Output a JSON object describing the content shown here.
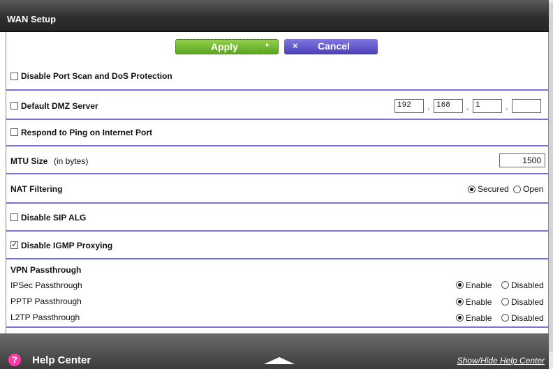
{
  "header": {
    "title": "WAN Setup"
  },
  "toolbar": {
    "apply_label": "Apply",
    "apply_arrow": "▸",
    "cancel_label": "Cancel",
    "cancel_x": "×"
  },
  "settings": {
    "disable_port_scan": {
      "label": "Disable Port Scan and DoS Protection",
      "checked": false
    },
    "default_dmz": {
      "label": "Default DMZ Server",
      "checked": false,
      "ip": [
        "192",
        "168",
        "1",
        ""
      ]
    },
    "respond_ping": {
      "label": "Respond to Ping on Internet Port",
      "checked": false
    },
    "mtu": {
      "label": "MTU Size",
      "unit": "(in bytes)",
      "value": "1500"
    },
    "nat_filtering": {
      "label": "NAT Filtering",
      "options": [
        "Secured",
        "Open"
      ],
      "selected": "Secured"
    },
    "disable_sip_alg": {
      "label": "Disable SIP ALG",
      "checked": false
    },
    "disable_igmp": {
      "label": "Disable IGMP Proxying",
      "checked": true
    }
  },
  "vpn": {
    "title": "VPN Passthrough",
    "items": [
      {
        "label": "IPSec Passthrough",
        "enable": "Enable",
        "disabled": "Disabled",
        "selected": "Enable"
      },
      {
        "label": "PPTP Passthrough",
        "enable": "Enable",
        "disabled": "Disabled",
        "selected": "Enable"
      },
      {
        "label": "L2TP Passthrough",
        "enable": "Enable",
        "disabled": "Disabled",
        "selected": "Enable"
      }
    ]
  },
  "footer": {
    "help_icon": "?",
    "help_label": "Help Center",
    "show_hide": "Show/Hide Help Center"
  },
  "colors": {
    "divider": "#7a73d6",
    "apply_green": "#5aa51f",
    "cancel_purple": "#4a3fb8",
    "help_pink": "#ff3aa4"
  }
}
